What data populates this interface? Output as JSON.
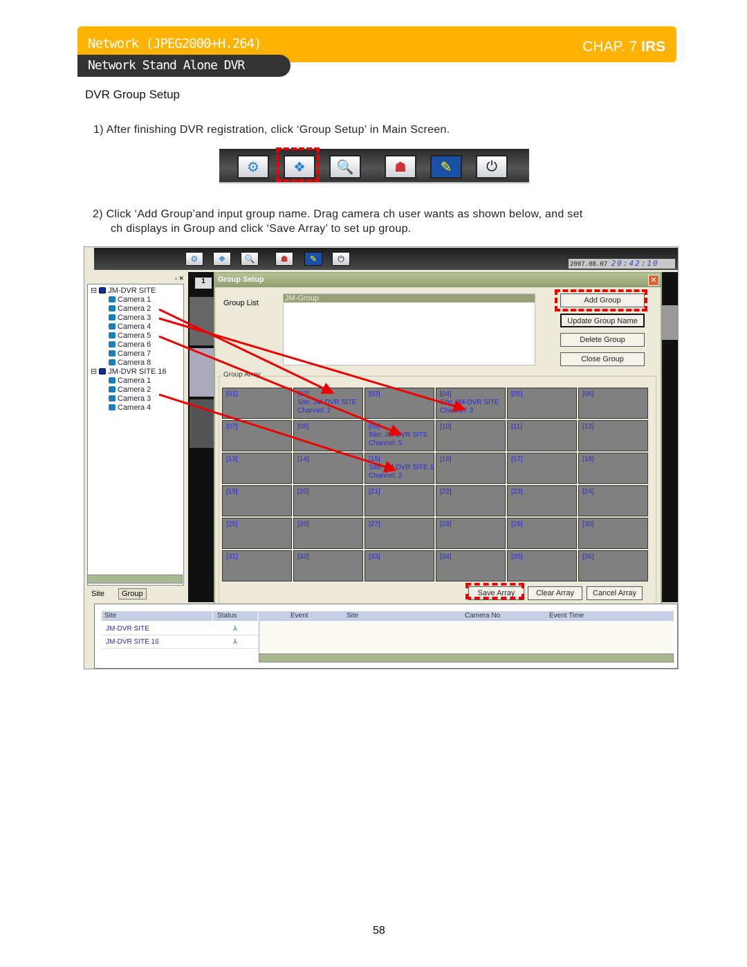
{
  "header": {
    "title": "Network (JPEG2000+H.264)",
    "chapter": "CHAP. 7",
    "brand": "IRS",
    "subtitle": "Network Stand Alone DVR"
  },
  "section_title": "DVR Group Setup",
  "step1": "1)  After finishing DVR registration, click ‘Group Setup’ in Main Screen.",
  "step2_line1": "2) Click ‘Add Group’and input group name. Drag camera ch user wants as shown below, and set",
  "step2_line2": "ch displays in Group and click ‘Save Array’ to set up group.",
  "toolbar_icons": [
    "setup-icon",
    "group-setup-icon",
    "search-icon",
    "network-icon",
    "event-log-icon",
    "power-icon"
  ],
  "app": {
    "date": "2007.08.07",
    "time": "20:42:10",
    "tab_number": "1",
    "tree": [
      {
        "label": "JM-DVR SITE",
        "type": "site"
      },
      {
        "label": "Camera 1"
      },
      {
        "label": "Camera 2"
      },
      {
        "label": "Camera 3"
      },
      {
        "label": "Camera 4"
      },
      {
        "label": "Camera 5"
      },
      {
        "label": "Camera 6"
      },
      {
        "label": "Camera 7"
      },
      {
        "label": "Camera 8"
      },
      {
        "label": "JM-DVR SITE 16",
        "type": "site"
      },
      {
        "label": "Camera 1"
      },
      {
        "label": "Camera 2"
      },
      {
        "label": "Camera 3"
      },
      {
        "label": "Camera 4"
      }
    ],
    "tabs": [
      "Site",
      "Group"
    ],
    "dialog": {
      "title": "Group Setup",
      "group_list_label": "Group List",
      "group_list_item": "JM-Group",
      "buttons": {
        "add": "Add Group",
        "update": "Update Group Name",
        "delete": "Delete Group",
        "close": "Close Group"
      },
      "group_array_label": "Group Array",
      "cells": [
        "[01]",
        "[02]\nSite: JM-DVR SITE\nChannel: 2",
        "[03]",
        "[04]\nSite: JM-DVR SITE\nChannel: 3",
        "[05]",
        "[06]",
        "[07]",
        "[08]",
        "[09]\nSite: JM-DVR SITE\nChannel: 5",
        "[10]",
        "[11]",
        "[12]",
        "[13]",
        "[14]",
        "[15]\nSite: JM-DVR SITE 16\nChannel: 2",
        "[16]",
        "[17]",
        "[18]",
        "[19]",
        "[20]",
        "[21]",
        "[22]",
        "[23]",
        "[24]",
        "[25]",
        "[26]",
        "[27]",
        "[28]",
        "[29]",
        "[30]",
        "[31]",
        "[32]",
        "[33]",
        "[34]",
        "[35]",
        "[36]"
      ],
      "array_buttons": {
        "save": "Save Array",
        "clear": "Clear Array",
        "cancel": "Cancel Array"
      }
    },
    "site_table": {
      "headers": [
        "Site",
        "Status"
      ],
      "rows": [
        "JM-DVR SITE",
        "JM-DVR SITE 16"
      ]
    },
    "event_table": {
      "headers": [
        "",
        "Event",
        "Site",
        "Camera No",
        "Event Time"
      ]
    }
  },
  "highlight_color": "#e00000",
  "page_number": "58"
}
